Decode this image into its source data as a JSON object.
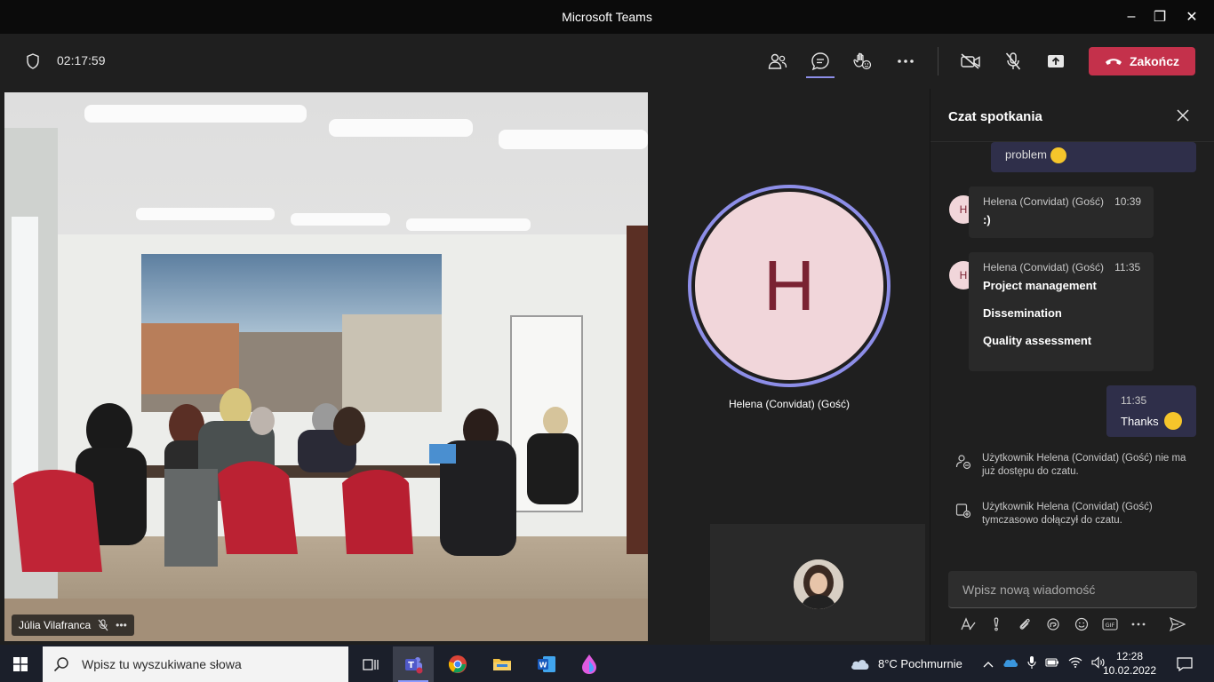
{
  "window": {
    "title": "Microsoft Teams",
    "minimize": "–",
    "maximize": "❐",
    "close": "✕"
  },
  "toolbar": {
    "timer": "02:17:59",
    "hangup_label": "Zakończ"
  },
  "video": {
    "participant_name": "Júlia Vilafranca"
  },
  "tile": {
    "initial": "H",
    "name": "Helena (Convidat) (Gość)"
  },
  "chat": {
    "title": "Czat spotkania",
    "prev_fragment": "problem",
    "messages": [
      {
        "initial": "H",
        "author": "Helena (Convidat) (Gość)",
        "time": "10:39",
        "lines": [
          ":)"
        ]
      },
      {
        "initial": "H",
        "author": "Helena (Convidat) (Gość)",
        "time": "11:35",
        "lines": [
          "Project management",
          "Dissemination",
          "Quality assessment"
        ]
      }
    ],
    "mine": {
      "time": "11:35",
      "text": "Thanks"
    },
    "system": [
      "Użytkownik Helena (Convidat) (Gość) nie ma już dostępu do czatu.",
      "Użytkownik Helena (Convidat) (Gość) tymczasowo dołączył do czatu."
    ],
    "compose_placeholder": "Wpisz nową wiadomość"
  },
  "taskbar": {
    "search_placeholder": "Wpisz tu wyszukiwane słowa",
    "weather": "8°C  Pochmurnie",
    "time": "12:28",
    "date": "10.02.2022"
  },
  "colors": {
    "accent": "#8d8ee8",
    "hangup": "#c4314b",
    "avatar_bg": "#f1d6da",
    "avatar_text": "#7a2232"
  }
}
